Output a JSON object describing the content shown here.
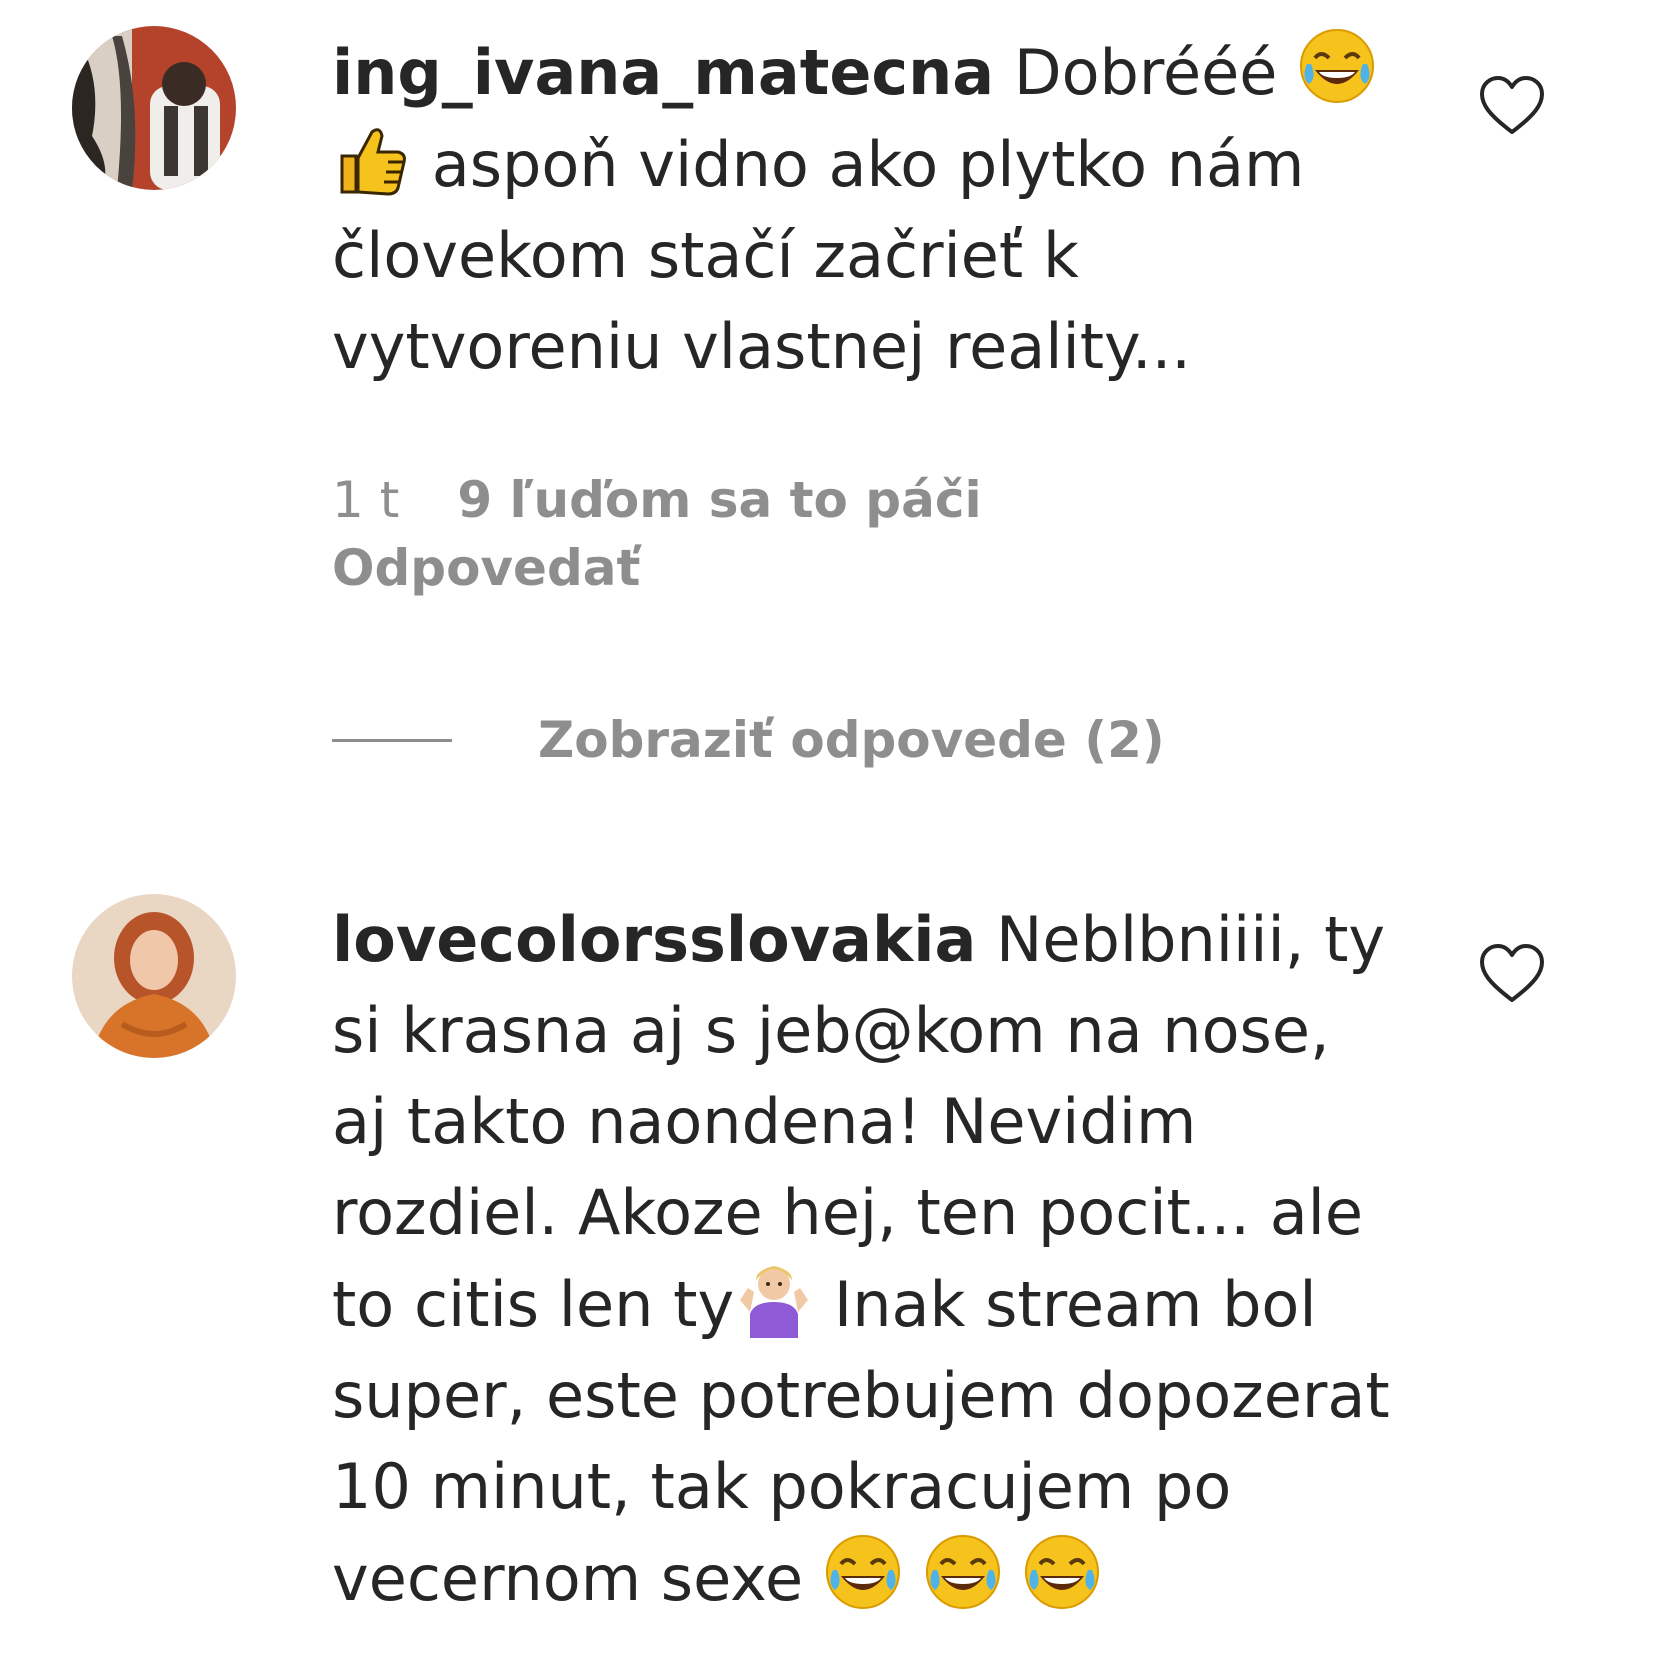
{
  "comments": [
    {
      "username": "ing_ivana_matecna",
      "text_parts": [
        "Dobrééé",
        "aspoň vidno ako plytko nám človekom stačí začrieť k vytvoreniu vlastnej reality..."
      ],
      "emojis": [
        "joy-emoji",
        "thumbs-up-emoji"
      ],
      "time": "1 t",
      "likes": "9 ľuďom sa to páči",
      "reply_label": "Odpovedať",
      "view_replies_label": "Zobraziť odpovede (2)"
    },
    {
      "username": "lovecolorsslovakia",
      "text_parts": [
        "Neblbniiii, ty si krasna aj s jeb@kom na nose, aj takto naondena! Nevidim rozdiel. Akoze hej, ten pocit... ale to citis len ty",
        "Inak stream bol super, este potrebujem dopozerat 10 minut, tak pokracujem po vecernom sexe"
      ],
      "emojis": [
        "shrug-emoji",
        "joy-emoji",
        "joy-emoji",
        "joy-emoji"
      ]
    }
  ],
  "colors": {
    "text": "#262626",
    "secondary": "#8e8e8e",
    "background": "#ffffff"
  }
}
